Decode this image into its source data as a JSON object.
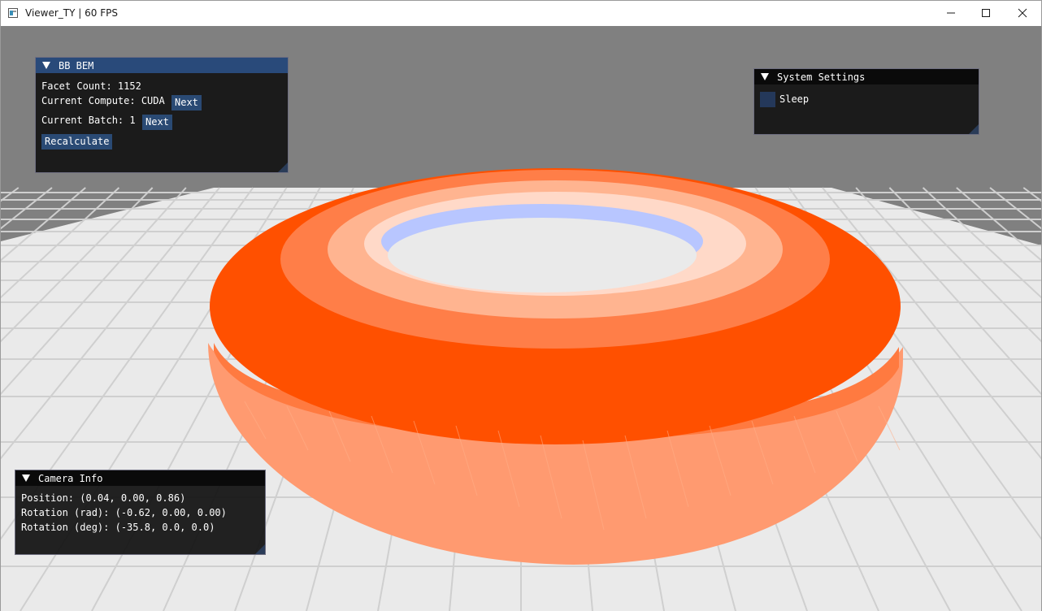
{
  "window": {
    "title": "Viewer_TY | 60 FPS",
    "minimize_icon": "minimize-icon",
    "maximize_icon": "maximize-icon",
    "close_icon": "close-icon"
  },
  "bem_panel": {
    "title": "BB BEM",
    "facet_count_text": "Facet Count: 1152",
    "compute_text": "Current Compute: CUDA",
    "compute_next_label": "Next",
    "batch_text": "Current Batch: 1",
    "batch_next_label": "Next",
    "recalculate_label": "Recalculate"
  },
  "system_panel": {
    "title": "System Settings",
    "sleep_label": "Sleep",
    "sleep_checked": false
  },
  "camera_panel": {
    "title": "Camera Info",
    "position_text": "Position: (0.04, 0.00, 0.86)",
    "rotation_rad_text": "Rotation (rad): (-0.62, 0.00, 0.00)",
    "rotation_deg_text": "Rotation (deg): (-35.8, 0.0, 0.0)"
  },
  "scene": {
    "background_color": "#808080",
    "floor_color": "#eaeaea",
    "grid_line_color": "#cfcfcf",
    "torus_colors": {
      "top": "#ff5000",
      "outer_lower": "#ff9a70",
      "inner_highlight": "#ffd9c8",
      "inner_hole": "#b8c6ff"
    }
  },
  "accent": {
    "active_header": "#294a7a",
    "button": "#2a4a74",
    "panel_bg": "#141414"
  }
}
